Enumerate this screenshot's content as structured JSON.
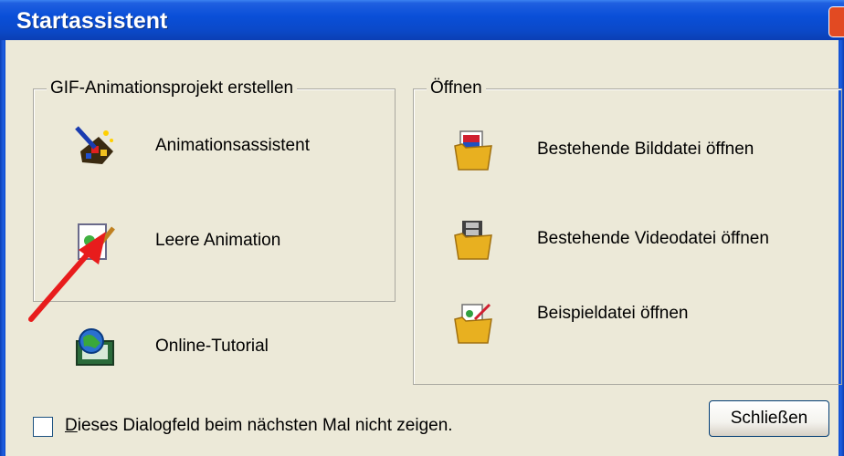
{
  "window": {
    "title": "Startassistent"
  },
  "create_group": {
    "legend": "GIF-Animationsprojekt erstellen",
    "items": [
      {
        "label": "Animationsassistent",
        "icon": "wizard-icon"
      },
      {
        "label": "Leere Animation",
        "icon": "new-document-icon"
      }
    ]
  },
  "online_tutorial": {
    "label": "Online-Tutorial",
    "icon": "globe-computer-icon"
  },
  "open_group": {
    "legend": "Öffnen",
    "items": [
      {
        "label": "Bestehende Bilddatei öffnen",
        "icon": "open-image-folder-icon"
      },
      {
        "label": "Bestehende Videodatei öffnen",
        "icon": "open-video-folder-icon"
      },
      {
        "label": "Beispieldatei öffnen",
        "icon": "open-sample-folder-icon"
      }
    ]
  },
  "footer": {
    "checkbox_label": "Dieses Dialogfeld beim nächsten Mal nicht zeigen.",
    "checkbox_checked": false,
    "close_label": "Schließen"
  },
  "colors": {
    "titlebar": "#0a4fd8",
    "dialog_bg": "#ece9d8",
    "annotation_arrow": "#e81c1c"
  }
}
